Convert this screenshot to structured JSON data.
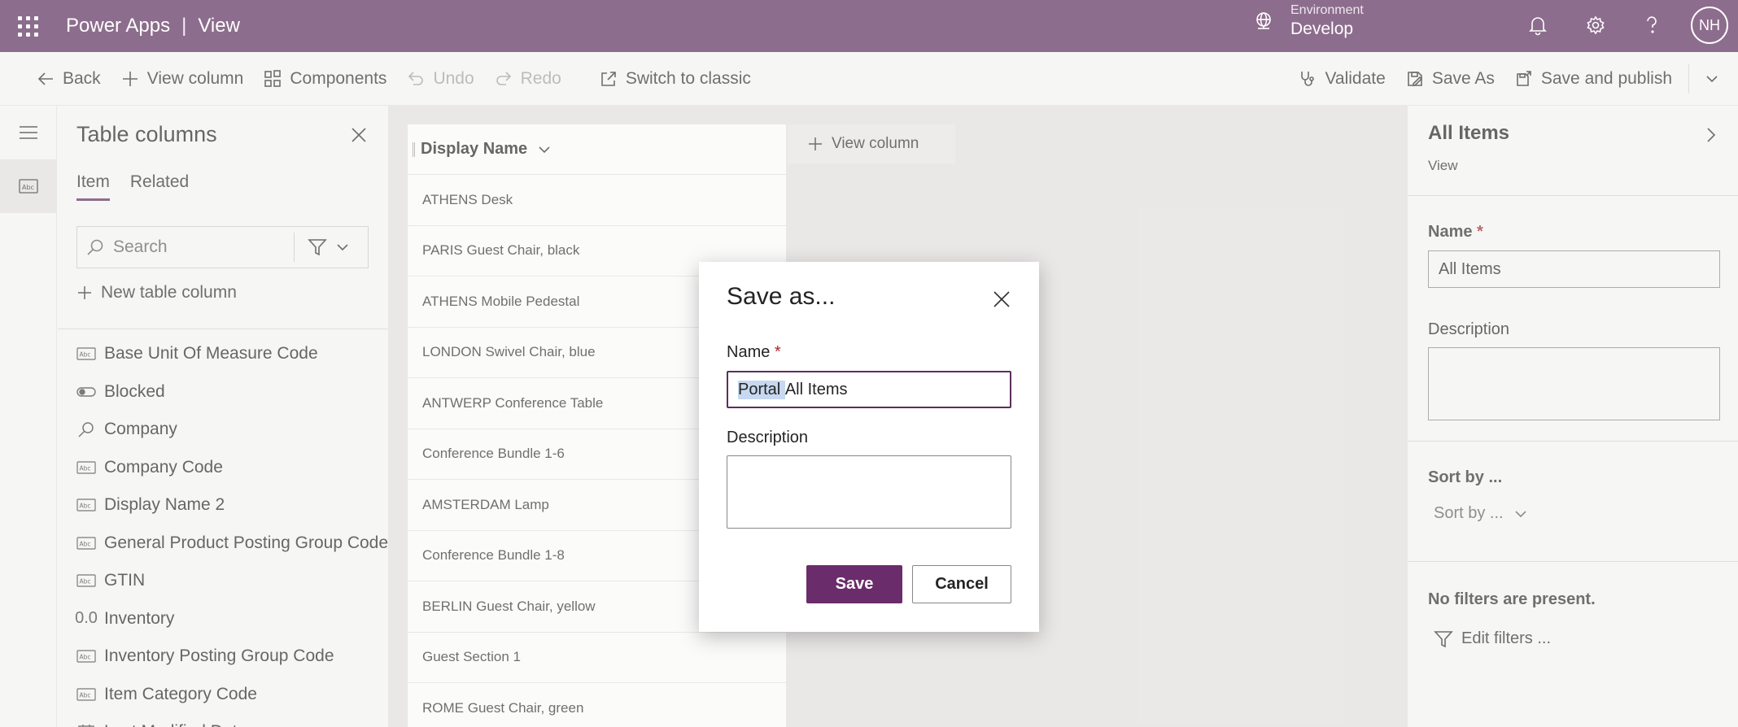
{
  "appbar": {
    "app_name": "Power Apps",
    "separator": "|",
    "page_name": "View",
    "environment_label": "Environment",
    "environment_value": "Develop",
    "avatar_initials": "NH"
  },
  "commandbar": {
    "back": "Back",
    "view_column": "View column",
    "components": "Components",
    "undo": "Undo",
    "redo": "Redo",
    "switch_classic": "Switch to classic",
    "validate": "Validate",
    "save_as": "Save As",
    "save_publish": "Save and publish"
  },
  "columns_panel": {
    "title": "Table columns",
    "tabs": [
      "Item",
      "Related"
    ],
    "active_tab": "Item",
    "search_placeholder": "Search",
    "new_column": "New table column",
    "items": [
      {
        "label": "Base Unit Of Measure Code",
        "icon": "text-abc-icon"
      },
      {
        "label": "Blocked",
        "icon": "toggle-icon"
      },
      {
        "label": "Company",
        "icon": "lookup-search-icon"
      },
      {
        "label": "Company Code",
        "icon": "text-abc-icon"
      },
      {
        "label": "Display Name 2",
        "icon": "text-abc-icon"
      },
      {
        "label": "General Product Posting Group Code",
        "icon": "text-abc-icon"
      },
      {
        "label": "GTIN",
        "icon": "text-abc-icon"
      },
      {
        "label": "Inventory",
        "icon": "decimal-icon"
      },
      {
        "label": "Inventory Posting Group Code",
        "icon": "text-abc-icon"
      },
      {
        "label": "Item Category Code",
        "icon": "text-abc-icon"
      },
      {
        "label": "Last Modified Date",
        "icon": "calendar-icon"
      }
    ]
  },
  "grid": {
    "header": "Display Name",
    "add_column": "View column",
    "rows": [
      "ATHENS Desk",
      "PARIS Guest Chair, black",
      "ATHENS Mobile Pedestal",
      "LONDON Swivel Chair, blue",
      "ANTWERP Conference Table",
      "Conference Bundle 1-6",
      "AMSTERDAM Lamp",
      "Conference Bundle 1-8",
      "BERLIN Guest Chair, yellow",
      "Guest Section 1",
      "ROME Guest Chair, green"
    ]
  },
  "dialog": {
    "title": "Save as...",
    "name_label": "Name",
    "required_mark": "*",
    "name_value_selected": "Portal ",
    "name_value_rest": "All Items",
    "description_label": "Description",
    "save": "Save",
    "cancel": "Cancel"
  },
  "properties": {
    "title": "All Items",
    "subtitle": "View",
    "name_label": "Name",
    "required_mark": "*",
    "name_value": "All Items",
    "description_label": "Description",
    "sort_label": "Sort by ...",
    "sort_dropdown": "Sort by ...",
    "filters_text": "No filters are present.",
    "edit_filters": "Edit filters ..."
  },
  "colors": {
    "brand": "#5c2e5c",
    "primary_button": "#6b2c6b",
    "required": "#a4262c",
    "selection": "#c7d8f0"
  }
}
